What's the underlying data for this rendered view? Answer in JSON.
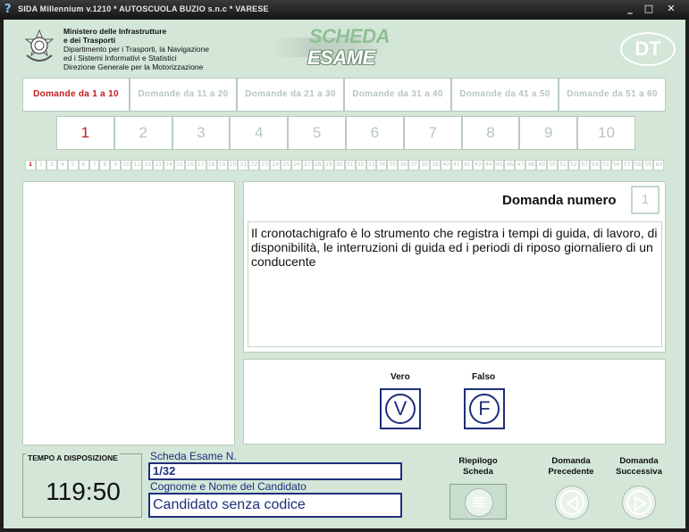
{
  "window": {
    "title": "SIDA Millennium v.1210 * AUTOSCUOLA BUZIO s.n.c * VARESE",
    "minimize": "_",
    "maximize": "□",
    "close": "✕"
  },
  "header": {
    "ministry_lines": [
      "Ministero delle Infrastrutture",
      "e dei Trasporti",
      "Dipartimento per i Trasporti, la Navigazione",
      "ed i Sistemi Informativi e Statistici",
      "Direzione Generale per la Motorizzazione"
    ],
    "logo_line1": "SCHEDA",
    "logo_line2": "ESAME",
    "badge": "DT"
  },
  "range_tabs": [
    {
      "label": "Domande  da 1 a 10",
      "active": true
    },
    {
      "label": "Domande  da 11 a 20",
      "active": false
    },
    {
      "label": "Domande  da 21 a 30",
      "active": false
    },
    {
      "label": "Domande  da 31 a 40",
      "active": false
    },
    {
      "label": "Domande  da 41 a 50",
      "active": false
    },
    {
      "label": "Domande  da 51 a 60",
      "active": false
    }
  ],
  "question_numbers": [
    "1",
    "2",
    "3",
    "4",
    "5",
    "6",
    "7",
    "8",
    "9",
    "10"
  ],
  "active_question_index": 0,
  "strip_count": 60,
  "question": {
    "label": "Domanda numero",
    "number": "1",
    "text": "Il cronotachigrafo è lo strumento che registra i tempi di guida, di lavoro, di disponibilità, le interruzioni di guida ed i periodi di riposo giornaliero di un conducente"
  },
  "answers": {
    "true_label": "Vero",
    "true_letter": "V",
    "false_label": "Falso",
    "false_letter": "F"
  },
  "footer": {
    "timer_label": "TEMPO A DISPOSIZIONE",
    "timer_value": "119:50",
    "scheda_label": "Scheda Esame N.",
    "scheda_value": "1/32",
    "candidate_label": "Cognome e Nome del Candidato",
    "candidate_value": "Candidato senza codice",
    "riepilogo_line1": "Riepilogo",
    "riepilogo_line2": "Scheda",
    "prev_line1": "Domanda",
    "prev_line2": "Precedente",
    "next_line1": "Domanda",
    "next_line2": "Successiva"
  },
  "colors": {
    "background": "#d3e6d8",
    "active_red": "#c21b1b",
    "inactive_text": "#b8c7bc",
    "navy": "#1e2f7a"
  }
}
